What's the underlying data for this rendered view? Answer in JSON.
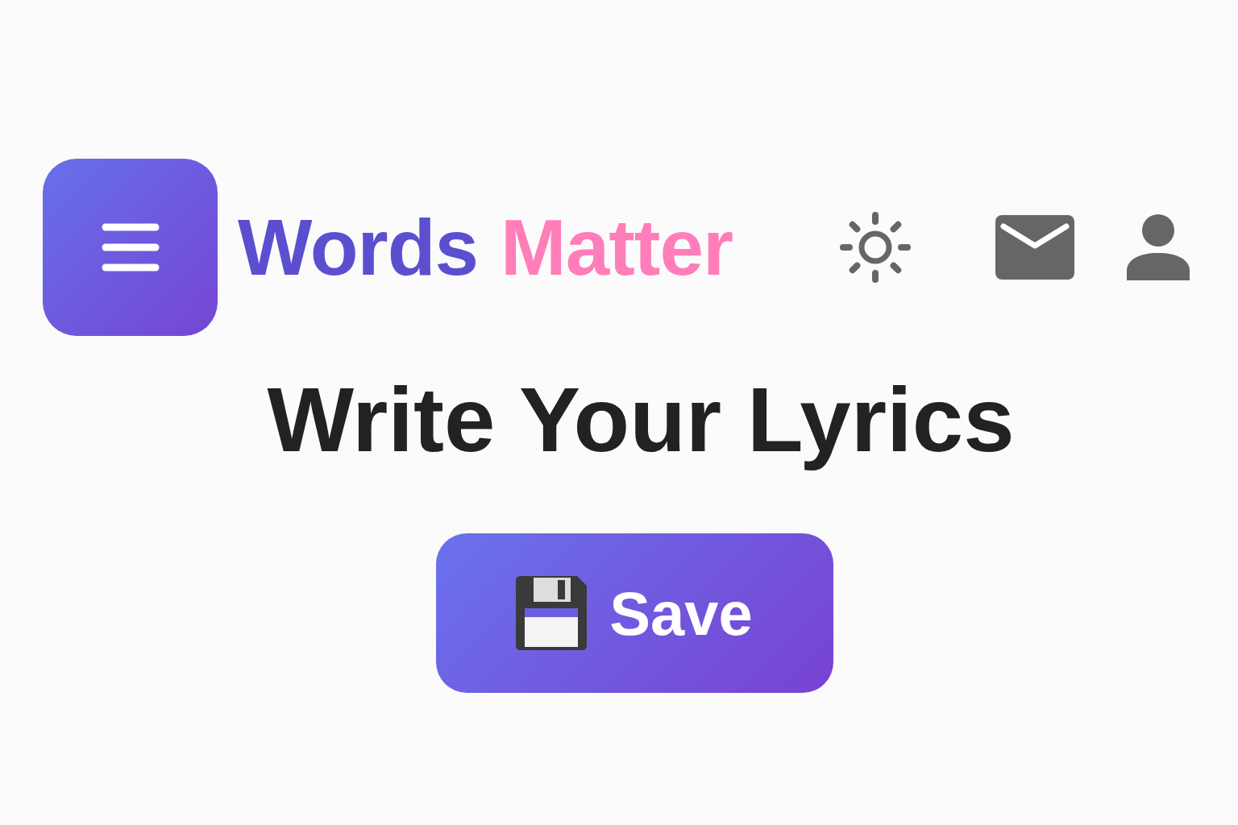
{
  "header": {
    "brand": [
      {
        "text": "Words",
        "color": "#5b4fd0"
      },
      {
        "text": "Matter",
        "color": "#ff7eb9"
      }
    ]
  },
  "heading": "Write Your Lyrics",
  "save_button": {
    "label": "Save"
  }
}
